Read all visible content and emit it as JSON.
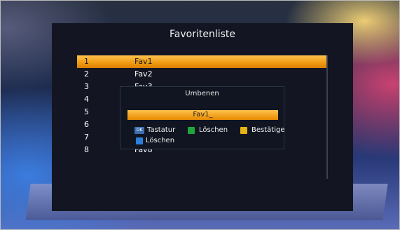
{
  "screen": {
    "title": "Favoritenliste"
  },
  "favorites": {
    "selected_index": 0,
    "rows": [
      {
        "num": "1",
        "name": "Fav1"
      },
      {
        "num": "2",
        "name": "Fav2"
      },
      {
        "num": "3",
        "name": "Fav3"
      },
      {
        "num": "4",
        "name": ""
      },
      {
        "num": "5",
        "name": ""
      },
      {
        "num": "6",
        "name": ""
      },
      {
        "num": "7",
        "name": ""
      },
      {
        "num": "8",
        "name": "Fav8"
      }
    ]
  },
  "rename_dialog": {
    "title": "Umbenen",
    "input_value": "Fav1_",
    "hints": {
      "ok_key": "OK",
      "keyboard_label": "Tastatur",
      "green_label": "Löschen",
      "yellow_label": "Bestätige",
      "blue_label": "Löschen"
    }
  },
  "colors": {
    "highlight": "#f0a020",
    "green_key": "#21a53a",
    "yellow_key": "#e7b416",
    "blue_key": "#2a7fd8"
  }
}
